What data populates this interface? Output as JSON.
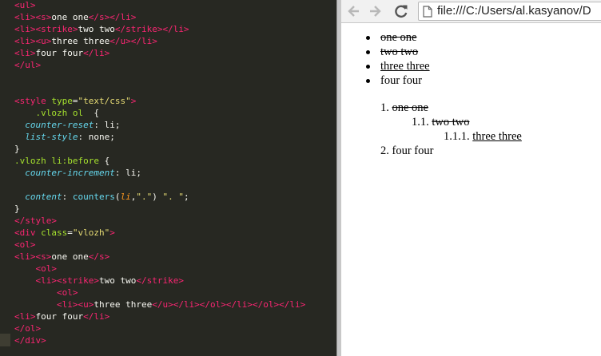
{
  "editor": {
    "lines": [
      [
        {
          "c": "t-tag",
          "t": "<ul>"
        }
      ],
      [
        {
          "c": "t-tag",
          "t": "<li><s>"
        },
        {
          "c": "",
          "t": "one one"
        },
        {
          "c": "t-tag",
          "t": "</s></li>"
        }
      ],
      [
        {
          "c": "t-tag",
          "t": "<li><strike>"
        },
        {
          "c": "",
          "t": "two two"
        },
        {
          "c": "t-tag",
          "t": "</strike></li>"
        }
      ],
      [
        {
          "c": "t-tag",
          "t": "<li><u>"
        },
        {
          "c": "",
          "t": "three three"
        },
        {
          "c": "t-tag",
          "t": "</u></li>"
        }
      ],
      [
        {
          "c": "t-tag",
          "t": "<li>"
        },
        {
          "c": "",
          "t": "four four"
        },
        {
          "c": "t-tag",
          "t": "</li>"
        }
      ],
      [
        {
          "c": "t-tag",
          "t": "</ul>"
        }
      ],
      [],
      [],
      [
        {
          "c": "t-tag",
          "t": "<style "
        },
        {
          "c": "t-attr",
          "t": "type"
        },
        {
          "c": "",
          "t": "="
        },
        {
          "c": "t-str",
          "t": "\"text/css\""
        },
        {
          "c": "t-tag",
          "t": ">"
        }
      ],
      [
        {
          "c": "",
          "t": "    "
        },
        {
          "c": "t-sel",
          "t": ".vlozh ol"
        },
        {
          "c": "",
          "t": "  {"
        }
      ],
      [
        {
          "c": "",
          "t": "  "
        },
        {
          "c": "t-prop",
          "t": "counter-reset"
        },
        {
          "c": "",
          "t": ": li;"
        }
      ],
      [
        {
          "c": "",
          "t": "  "
        },
        {
          "c": "t-prop",
          "t": "list-style"
        },
        {
          "c": "",
          "t": ": none;"
        }
      ],
      [
        {
          "c": "",
          "t": "}"
        }
      ],
      [
        {
          "c": "t-sel",
          "t": ".vlozh li:before"
        },
        {
          "c": "",
          "t": " {"
        }
      ],
      [
        {
          "c": "",
          "t": "  "
        },
        {
          "c": "t-prop",
          "t": "counter-increment"
        },
        {
          "c": "",
          "t": ": li;"
        }
      ],
      [],
      [
        {
          "c": "",
          "t": "  "
        },
        {
          "c": "t-prop",
          "t": "content"
        },
        {
          "c": "",
          "t": ": "
        },
        {
          "c": "t-fn",
          "t": "counters"
        },
        {
          "c": "",
          "t": "("
        },
        {
          "c": "t-arg",
          "t": "li"
        },
        {
          "c": "",
          "t": ","
        },
        {
          "c": "t-str",
          "t": "\".\""
        },
        {
          "c": "",
          "t": ") "
        },
        {
          "c": "t-str",
          "t": "\". \""
        },
        {
          "c": "",
          "t": ";"
        }
      ],
      [
        {
          "c": "",
          "t": "}"
        }
      ],
      [
        {
          "c": "t-tag",
          "t": "</style>"
        }
      ],
      [
        {
          "c": "t-tag",
          "t": "<div "
        },
        {
          "c": "t-attr",
          "t": "class"
        },
        {
          "c": "",
          "t": "="
        },
        {
          "c": "t-str",
          "t": "\"vlozh\""
        },
        {
          "c": "t-tag",
          "t": ">"
        }
      ],
      [
        {
          "c": "t-tag",
          "t": "<ol>"
        }
      ],
      [
        {
          "c": "t-tag",
          "t": "<li><s>"
        },
        {
          "c": "",
          "t": "one one"
        },
        {
          "c": "t-tag",
          "t": "</s>"
        }
      ],
      [
        {
          "c": "",
          "t": "    "
        },
        {
          "c": "t-tag",
          "t": "<ol>"
        }
      ],
      [
        {
          "c": "",
          "t": "    "
        },
        {
          "c": "t-tag",
          "t": "<li><strike>"
        },
        {
          "c": "",
          "t": "two two"
        },
        {
          "c": "t-tag",
          "t": "</strike>"
        }
      ],
      [
        {
          "c": "",
          "t": "        "
        },
        {
          "c": "t-tag",
          "t": "<ol>"
        }
      ],
      [
        {
          "c": "",
          "t": "        "
        },
        {
          "c": "t-tag",
          "t": "<li><u>"
        },
        {
          "c": "",
          "t": "three three"
        },
        {
          "c": "t-tag",
          "t": "</u></li></ol></li></ol></li>"
        }
      ],
      [
        {
          "c": "t-tag",
          "t": "<li>"
        },
        {
          "c": "",
          "t": "four four"
        },
        {
          "c": "t-tag",
          "t": "</li>"
        }
      ],
      [
        {
          "c": "t-tag",
          "t": "</ol>"
        }
      ],
      [
        {
          "c": "t-tag",
          "t": "</div>"
        }
      ]
    ]
  },
  "browser": {
    "url": "file:///C:/Users/al.kasyanov/D",
    "icons": {
      "back": "back-arrow-icon",
      "forward": "forward-arrow-icon",
      "reload": "reload-icon",
      "page": "page-icon"
    },
    "bullets": [
      {
        "text": "one one",
        "style": "strike"
      },
      {
        "text": "two two",
        "style": "strike"
      },
      {
        "text": "three three",
        "style": "underline"
      },
      {
        "text": "four four",
        "style": "none"
      }
    ],
    "ordered": [
      {
        "num": "1. ",
        "text": "one one",
        "style": "strike",
        "level": 0
      },
      {
        "num": "1.1. ",
        "text": "two two",
        "style": "strike",
        "level": 1
      },
      {
        "num": "1.1.1. ",
        "text": "three three",
        "style": "underline",
        "level": 2
      },
      {
        "num": "2. ",
        "text": "four four",
        "style": "none",
        "level": 0
      }
    ]
  }
}
